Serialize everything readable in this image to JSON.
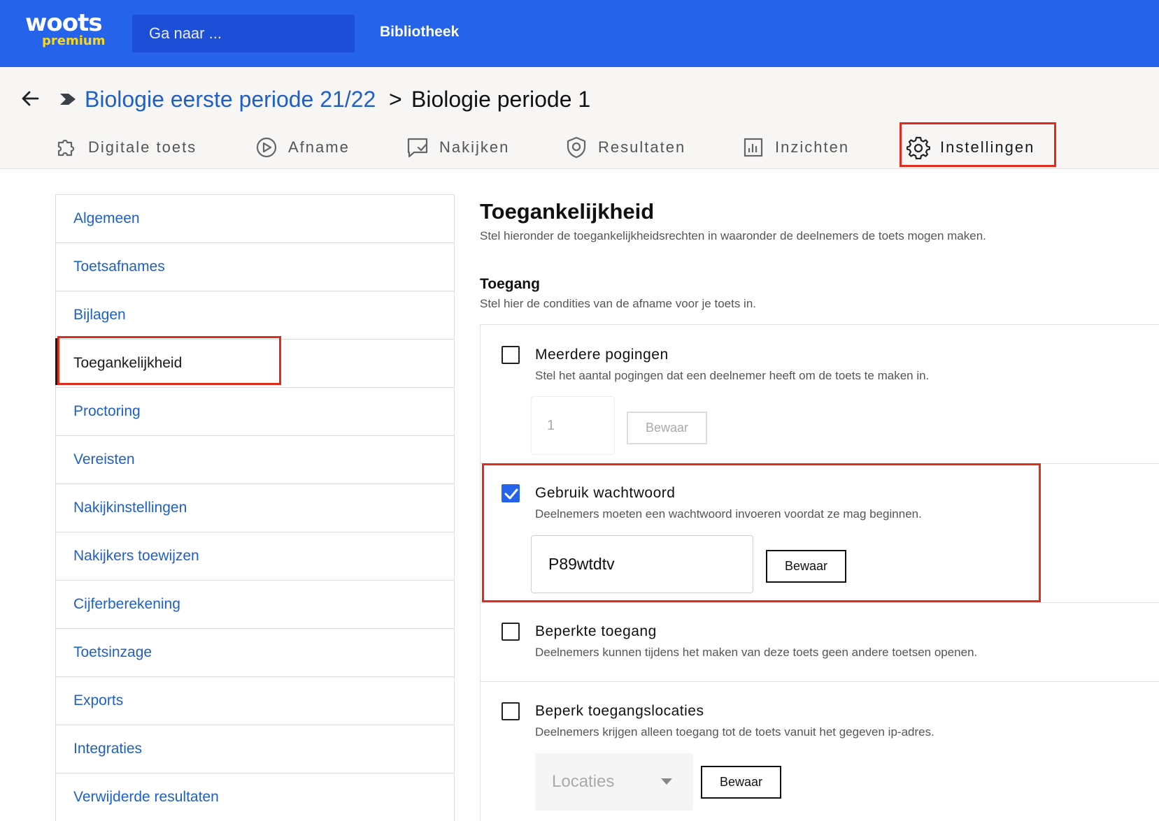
{
  "topbar": {
    "logo_main": "woots",
    "logo_sub": "premium",
    "search_placeholder": "Ga naar ...",
    "library_link": "Bibliotheek"
  },
  "breadcrumb": {
    "parent": "Biologie eerste periode 21/22",
    "separator": ">",
    "current": "Biologie periode 1"
  },
  "tabs": [
    {
      "label": "Digitale toets",
      "icon": "puzzle-icon"
    },
    {
      "label": "Afname",
      "icon": "play-circle-icon"
    },
    {
      "label": "Nakijken",
      "icon": "message-check-icon"
    },
    {
      "label": "Resultaten",
      "icon": "shield-icon"
    },
    {
      "label": "Inzichten",
      "icon": "bar-chart-icon"
    },
    {
      "label": "Instellingen",
      "icon": "gear-icon",
      "active": true
    }
  ],
  "sidebar": {
    "items": [
      {
        "label": "Algemeen"
      },
      {
        "label": "Toetsafnames"
      },
      {
        "label": "Bijlagen"
      },
      {
        "label": "Toegankelijkheid",
        "active": true
      },
      {
        "label": "Proctoring"
      },
      {
        "label": "Vereisten"
      },
      {
        "label": "Nakijkinstellingen"
      },
      {
        "label": "Nakijkers toewijzen"
      },
      {
        "label": "Cijferberekening"
      },
      {
        "label": "Toetsinzage"
      },
      {
        "label": "Exports"
      },
      {
        "label": "Integraties"
      },
      {
        "label": "Verwijderde resultaten"
      }
    ]
  },
  "main": {
    "title": "Toegankelijkheid",
    "subtitle": "Stel hieronder de toegankelijkheidsrechten in waaronder de deelnemers de toets mogen maken.",
    "section_title": "Toegang",
    "section_subtitle": "Stel hier de condities van de afname voor je toets in.",
    "options": {
      "attempts": {
        "title": "Meerdere pogingen",
        "description": "Stel het aantal pogingen dat een deelnemer heeft om de toets te maken in.",
        "checked": false,
        "input_value": "1",
        "save_label": "Bewaar"
      },
      "password": {
        "title": "Gebruik wachtwoord",
        "description": "Deelnemers moeten een wachtwoord invoeren voordat ze mag beginnen.",
        "checked": true,
        "input_value": "P89wtdtv",
        "save_label": "Bewaar"
      },
      "restricted": {
        "title": "Beperkte toegang",
        "description": "Deelnemers kunnen tijdens het maken van deze toets geen andere toetsen openen.",
        "checked": false
      },
      "locations": {
        "title": "Beperk toegangslocaties",
        "description": "Deelnemers krijgen alleen toegang tot de toets vanuit het gegeven ip-adres.",
        "checked": false,
        "select_placeholder": "Locaties",
        "save_label": "Bewaar"
      }
    }
  },
  "colors": {
    "brand_blue": "#2563eb",
    "link_blue": "#1f5fc8",
    "logo_yellow": "#f9d71c",
    "highlight_red": "#e02d1b"
  }
}
